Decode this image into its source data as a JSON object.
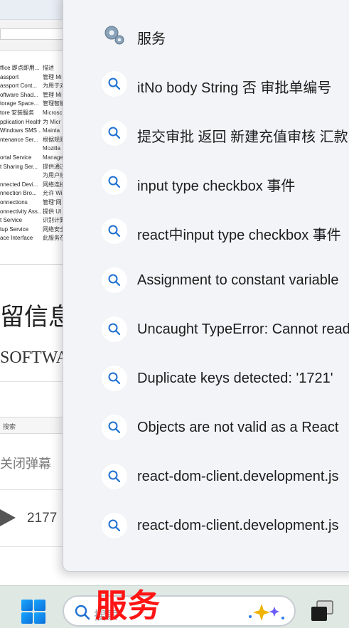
{
  "background": {
    "services_names": [
      "ffice 即点即用...",
      "assport",
      "assport Cont...",
      "oftware Shad...",
      "torage Space...",
      "tore 安装服务",
      "pplication Health...",
      "Windows SMS ...",
      "ntenance Ser...",
      "",
      "ortal Service",
      "t Sharing Ser...",
      "",
      "nnected Devi...",
      "nnection Bro...",
      "onnections",
      "onnectivity Ass...",
      "t Service",
      "tup Service",
      "ace Interface"
    ],
    "services_desc": [
      "描述",
      "管理 Mi",
      "为用于对",
      "管理 Mi",
      "管理智能",
      "Microsc",
      "为 Micr",
      "Mainta",
      "根据规则",
      "Mozilla",
      "Manage",
      "提供通过",
      "为用户帧",
      "网络连接",
      "允许 Wi",
      "管理“网",
      "提供 UI",
      "识别计算",
      "网络安全",
      "此服务在"
    ],
    "heading": "留信息",
    "subheading": "SOFTWA",
    "search_label": "搜索",
    "close_danmu": "关闭弹幕",
    "share_count": "2177"
  },
  "flyout": {
    "results": [
      {
        "icon": "services-gear-icon",
        "text": "服务"
      },
      {
        "icon": "search-icon",
        "text": "itNo body String 否 审批单编号"
      },
      {
        "icon": "search-icon",
        "text": "提交审批 返回 新建充值审核 汇款"
      },
      {
        "icon": "search-icon",
        "text": "input type checkbox 事件"
      },
      {
        "icon": "search-icon",
        "text": "react中input type checkbox 事件"
      },
      {
        "icon": "search-icon",
        "text": "Assignment to constant variable"
      },
      {
        "icon": "search-icon",
        "text": "Uncaught TypeError: Cannot read"
      },
      {
        "icon": "search-icon",
        "text": "Duplicate keys detected: '1721'"
      },
      {
        "icon": "search-icon",
        "text": "Objects are not valid as a React"
      },
      {
        "icon": "search-icon",
        "text": "react-dom-client.development.js"
      },
      {
        "icon": "search-icon",
        "text": "react-dom-client.development.js"
      }
    ]
  },
  "taskbar": {
    "search_placeholder": "搜索",
    "overlay_text": "服务"
  },
  "colors": {
    "accent": "#0a6fd9",
    "search_icon": "#1d6fd0",
    "overlay_red": "#ff1414"
  }
}
